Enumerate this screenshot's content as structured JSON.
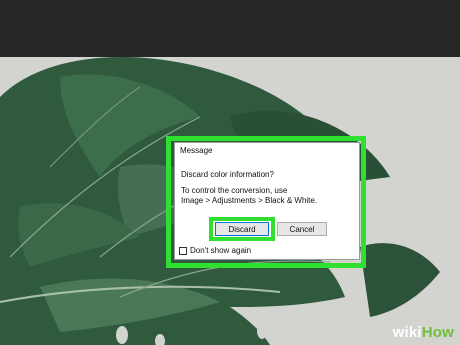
{
  "app": {
    "top_bar_color": "#262626"
  },
  "dialog": {
    "title": "Message",
    "question": "Discard color information?",
    "line1": "To control the conversion, use",
    "line2": "Image > Adjustments > Black & White.",
    "discard_label": "Discard",
    "cancel_label": "Cancel",
    "checkbox_label": "Don't show again",
    "checkbox_checked": false
  },
  "highlight_color": "#2fe02f",
  "watermark": {
    "prefix": "wiki",
    "suffix": "How"
  }
}
